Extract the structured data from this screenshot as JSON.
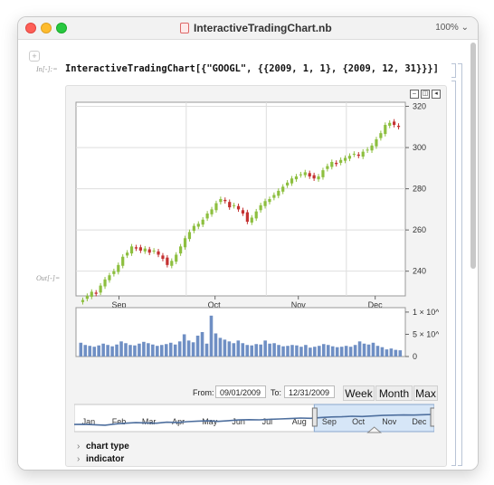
{
  "window": {
    "title": "InteractiveTradingChart.nb",
    "zoom": "100%"
  },
  "notebook": {
    "in_label": "In[-]:=",
    "out_label": "Out[-]=",
    "input_code": "InteractiveTradingChart[{\"GOOGL\", {{2009, 1, 1}, {2009, 12, 31}}}]"
  },
  "colors": {
    "up": "#8dbf3f",
    "down": "#c43131",
    "volume": "#6f8fc4",
    "overview_line": "#4e6f9e",
    "overview_highlight": "#d6e6f7"
  },
  "chart_data": {
    "type": "candlestick",
    "y_axis": {
      "ticks": [
        240,
        260,
        280,
        300,
        320
      ],
      "ylim": [
        228,
        322
      ],
      "side": "right"
    },
    "x_axis": {
      "ticks": [
        "Sep",
        "Oct",
        "Nov",
        "Dec"
      ]
    },
    "candles_close": [
      226,
      228,
      230,
      229,
      233,
      236,
      238,
      240,
      243,
      247,
      249,
      252,
      251,
      250,
      251,
      249,
      250,
      248,
      246,
      243,
      245,
      248,
      252,
      256,
      259,
      262,
      263,
      265,
      268,
      270,
      273,
      275,
      274,
      271,
      272,
      270,
      268,
      264,
      266,
      269,
      272,
      274,
      275,
      277,
      279,
      281,
      283,
      285,
      286,
      287,
      288,
      286,
      285,
      286,
      289,
      291,
      293,
      292,
      294,
      295,
      296,
      297,
      296,
      298,
      299,
      301,
      304,
      307,
      311,
      312,
      311,
      310
    ],
    "volume": {
      "ticks": [
        "0",
        "5 × 10^6",
        "1 × 10^7"
      ],
      "values": [
        3.1,
        2.6,
        2.4,
        2.2,
        2.5,
        2.9,
        2.6,
        2.3,
        2.7,
        3.4,
        3.0,
        2.6,
        2.5,
        2.9,
        3.3,
        3.0,
        2.7,
        2.4,
        2.6,
        2.8,
        3.1,
        2.7,
        3.4,
        5.0,
        3.6,
        3.2,
        4.7,
        5.5,
        2.9,
        9.2,
        5.2,
        4.2,
        3.8,
        3.4,
        3.0,
        3.6,
        3.0,
        2.6,
        2.5,
        2.8,
        2.7,
        3.6,
        2.9,
        3.0,
        2.6,
        2.3,
        2.4,
        2.6,
        2.5,
        2.2,
        2.6,
        2.0,
        2.2,
        2.4,
        2.8,
        2.6,
        2.3,
        2.1,
        2.2,
        2.4,
        2.2,
        2.6,
        3.4,
        2.9,
        2.7,
        3.1,
        2.4,
        2.1,
        1.6,
        1.8,
        1.5,
        1.4
      ]
    },
    "overview": {
      "months": [
        "Jan",
        "Feb",
        "Mar",
        "Apr",
        "May",
        "Jun",
        "Jul",
        "Aug",
        "Sep",
        "Oct",
        "Nov",
        "Dec"
      ],
      "values": [
        0.2,
        0.22,
        0.18,
        0.15,
        0.24,
        0.3,
        0.34,
        0.32,
        0.3,
        0.38,
        0.36,
        0.42,
        0.46,
        0.48,
        0.44,
        0.5,
        0.55,
        0.57,
        0.56,
        0.6,
        0.63,
        0.66,
        0.7,
        0.68,
        0.74,
        0.78,
        0.8,
        0.84,
        0.82,
        0.86,
        0.9,
        0.92,
        0.94,
        0.93,
        0.96,
        0.98
      ],
      "selected_range": [
        "Sep",
        "Dec"
      ]
    }
  },
  "controls": {
    "from_label": "From:",
    "from_value": "09/01/2009",
    "to_label": "To:",
    "to_value": "12/31/2009",
    "week": "Week",
    "month": "Month",
    "max": "Max"
  },
  "options": {
    "chart_type": "chart type",
    "indicator": "indicator"
  }
}
